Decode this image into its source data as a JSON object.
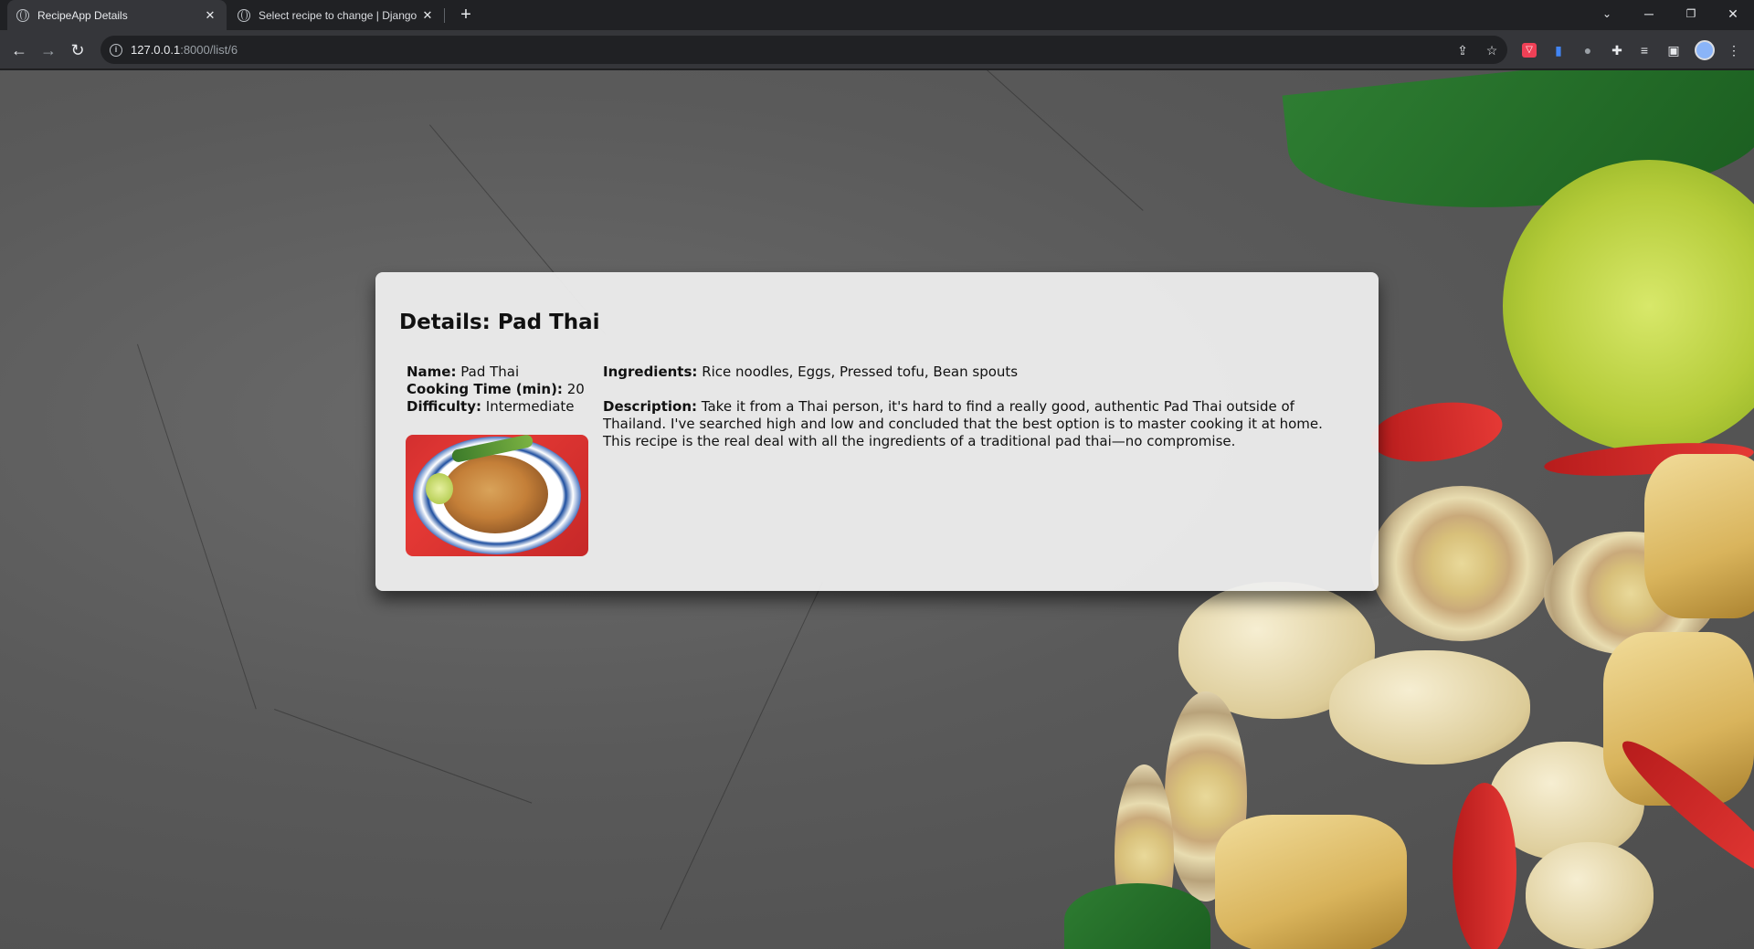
{
  "browser": {
    "tabs": [
      {
        "title": "RecipeApp Details",
        "active": true
      },
      {
        "title": "Select recipe to change | Django",
        "active": false
      }
    ],
    "url_host": "127.0.0.1",
    "url_path": ":8000/list/6"
  },
  "recipe": {
    "heading": "Details: Pad Thai",
    "name_label": "Name:",
    "name": "Pad Thai",
    "cooking_time_label": "Cooking Time (min):",
    "cooking_time": "20",
    "difficulty_label": "Difficulty:",
    "difficulty": "Intermediate",
    "ingredients_label": "Ingredients:",
    "ingredients": "Rice noodles, Eggs, Pressed tofu, Bean spouts",
    "description_label": "Description:",
    "description": "Take it from a Thai person, it's hard to find a really good, authentic Pad Thai outside of Thailand. I've searched high and low and concluded that the best option is to master cooking it at home. This recipe is the real deal with all the ingredients of a traditional pad thai—no compromise."
  },
  "icons": [
    "globe-icon",
    "close-icon",
    "plus-icon",
    "back-icon",
    "forward-icon",
    "reload-icon",
    "info-icon",
    "share-icon",
    "star-icon",
    "extensions-icon",
    "side-panel-icon",
    "menu-icon"
  ],
  "colors": {
    "chrome_dark": "#202124",
    "chrome_toolbar": "#35363a",
    "card_bg": "#eeeeee"
  }
}
